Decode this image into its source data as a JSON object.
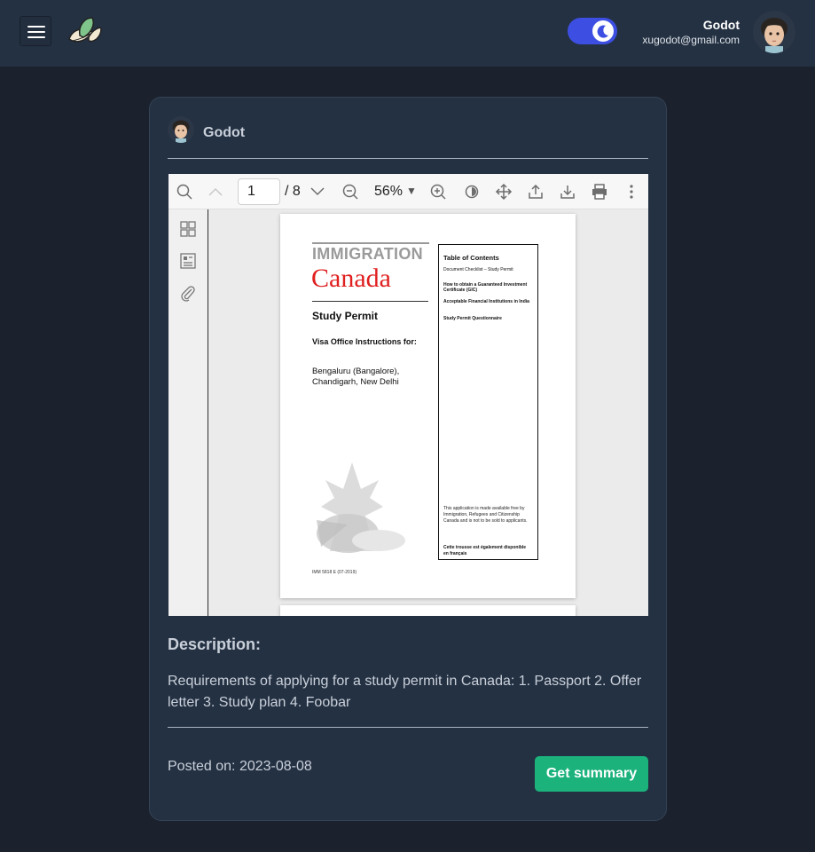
{
  "header": {
    "user_name": "Godot",
    "user_email": "xugodot@gmail.com",
    "theme_toggle_state": "dark"
  },
  "card": {
    "author_name": "Godot",
    "pdf_viewer": {
      "current_page": "1",
      "total_pages": "/ 8",
      "zoom": "56%",
      "document": {
        "heading_top": "IMMIGRATION",
        "heading_main": "Canada",
        "title": "Study Permit",
        "subtitle": "Visa Office Instructions for:",
        "cities": "Bengaluru (Bangalore), Chandigarh, New Delhi",
        "form_code": "IMM 5818 E (07-2019)",
        "toc_title": "Table of Contents",
        "toc_items": [
          "Document Checklist – Study Permit",
          "How to obtain a Guaranteed Investment Certificate (GIC)",
          "Acceptable Financial Institutions in India",
          "Study Permit Questionnaire"
        ],
        "toc_note": "This application is made available free by Immigration, Refugees and Citizenship Canada and is not to be sold to applicants.",
        "toc_french": "Cette trousse est également disponible en français"
      }
    },
    "description_label": "Description:",
    "description_text": "Requirements of applying for a study permit in Canada: 1. Passport 2. Offer letter 3. Study plan 4. Foobar",
    "posted_on": "Posted on: 2023-08-08",
    "summary_button": "Get summary"
  },
  "colors": {
    "background": "#1b222d",
    "panel": "#243142",
    "toggle": "#3d4fe3",
    "accent_button": "#1bb27c",
    "canada_red": "#e01f1f"
  }
}
